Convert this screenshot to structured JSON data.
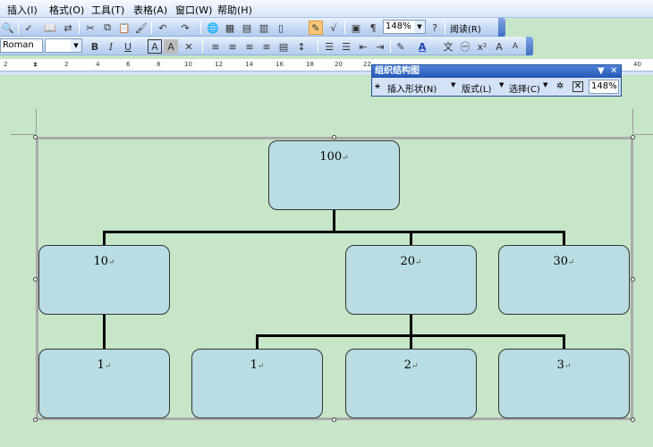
{
  "menu": [
    "插入(I)",
    "格式(O)",
    "工具(T)",
    "表格(A)",
    "窗口(W)",
    "帮助(H)"
  ],
  "toolbar1": {
    "zoom": "148%",
    "read_label": "阅读(R)"
  },
  "toolbar2": {
    "font_name": "Roman"
  },
  "ruler": [
    "2",
    "2",
    "4",
    "6",
    "8",
    "10",
    "12",
    "14",
    "16",
    "18",
    "20",
    "22",
    "40"
  ],
  "org_toolbar": {
    "title": "组织结构图",
    "insert_shape": "插入形状(N)",
    "layout": "版式(L)",
    "select": "选择(C)",
    "zoom": "148%"
  },
  "org_chart": {
    "root": "100",
    "level1": [
      "10",
      "20",
      "30"
    ],
    "level2": [
      "1",
      "1",
      "2",
      "3"
    ],
    "para_mark": "↵"
  }
}
